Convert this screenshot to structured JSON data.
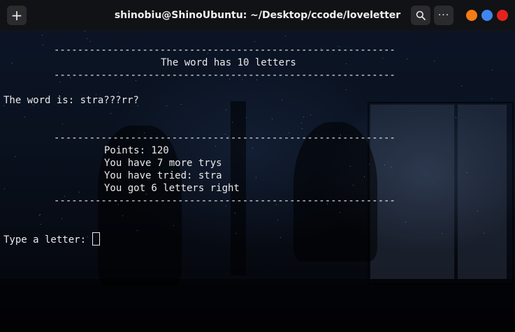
{
  "window": {
    "title": "shinobiu@ShinoUbuntu: ~/Desktop/ccode/loveletter",
    "new_tab_icon": "+",
    "menu_icon": "···",
    "colors": {
      "minimize": "#f57b16",
      "maximize": "#3f86f2",
      "close": "#e3221e",
      "text": "#eaeaea"
    }
  },
  "terminal": {
    "separator": "----------------------------------------------------------",
    "word_count_line": "The word has 10 letters",
    "word_is_line": "The word is: stra???rr?",
    "points_line": "Points: 120",
    "trys_line": "You have 7 more trys",
    "tried_line": "You have tried: stra",
    "right_line": "You got 6 letters right",
    "prompt": "Type a letter:"
  }
}
